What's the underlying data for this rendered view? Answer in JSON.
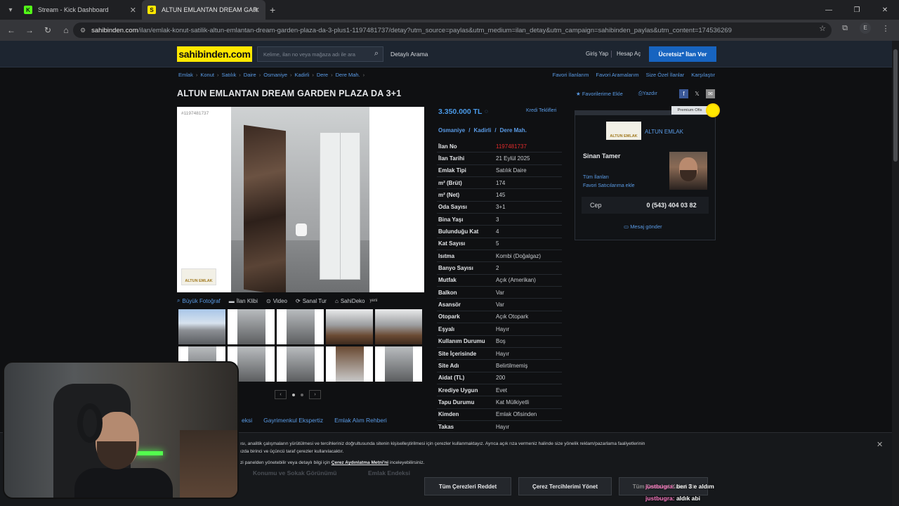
{
  "browser": {
    "tabs": [
      {
        "title": "Stream - Kick Dashboard",
        "favicon": "K"
      },
      {
        "title": "ALTUN EMLANTAN DREAM GAR",
        "favicon": "S"
      }
    ],
    "url_host": "sahibinden.com",
    "url_path": "/ilan/emlak-konut-satilik-altun-emlantan-dream-garden-plaza-da-3-plus1-1197481737/detay?utm_source=paylas&utm_medium=ilan_detay&utm_campaign=sahibinden_paylas&utm_content=174536269",
    "profile_initial": "E"
  },
  "header": {
    "logo": "sahibinden.com",
    "search_placeholder": "Kelime, ilan no veya mağaza adı ile ara",
    "detayli": "Detaylı Arama",
    "giris": "Giriş Yap",
    "hesap": "Hesap Aç",
    "cta": "Ücretsiz* İlan Ver"
  },
  "breadcrumbs": [
    "Emlak",
    "Konut",
    "Satılık",
    "Daire",
    "Osmaniye",
    "Kadirli",
    "Dere",
    "Dere Mah."
  ],
  "toplinks": [
    "Favori İlanlarım",
    "Favori Aramalarım",
    "Size Özel İlanlar",
    "Karşılaştır"
  ],
  "listing": {
    "title": "ALTUN EMLANTAN DREAM GARDEN PLAZA DA 3+1",
    "favorite": "Favorilerime Ekle",
    "print": "Yazdır",
    "photo_id": "#1197481737",
    "photo_tabs": [
      "Büyük Fotoğraf",
      "İlan Klibi",
      "Video",
      "Sanal Tur",
      "SahiDeko"
    ],
    "yeni": "yeni",
    "links": [
      "Gayrimenkul Ekspertiz",
      "Emlak Alım Rehberi"
    ],
    "links_partial": "eksi",
    "price": "3.350.000 TL",
    "kredi": "Kredi Teklifleri",
    "location": [
      "Osmaniye",
      "/",
      "Kadirli",
      "/",
      "Dere Mah."
    ],
    "details": [
      {
        "label": "İlan No",
        "value": "1197481737"
      },
      {
        "label": "İlan Tarihi",
        "value": "21 Eylül 2025"
      },
      {
        "label": "Emlak Tipi",
        "value": "Satılık Daire"
      },
      {
        "label": "m² (Brüt)",
        "value": "174"
      },
      {
        "label": "m² (Net)",
        "value": "145"
      },
      {
        "label": "Oda Sayısı",
        "value": "3+1"
      },
      {
        "label": "Bina Yaşı",
        "value": "3"
      },
      {
        "label": "Bulunduğu Kat",
        "value": "4"
      },
      {
        "label": "Kat Sayısı",
        "value": "5"
      },
      {
        "label": "Isıtma",
        "value": "Kombi (Doğalgaz)"
      },
      {
        "label": "Banyo Sayısı",
        "value": "2"
      },
      {
        "label": "Mutfak",
        "value": "Açık (Amerikan)"
      },
      {
        "label": "Balkon",
        "value": "Var"
      },
      {
        "label": "Asansör",
        "value": "Var"
      },
      {
        "label": "Otopark",
        "value": "Açık Otopark"
      },
      {
        "label": "Eşyalı",
        "value": "Hayır"
      },
      {
        "label": "Kullanım Durumu",
        "value": "Boş"
      },
      {
        "label": "Site İçerisinde",
        "value": "Hayır"
      },
      {
        "label": "Site Adı",
        "value": "Belirtilmemiş"
      },
      {
        "label": "Aidat (TL)",
        "value": "200"
      },
      {
        "label": "Krediye Uygun",
        "value": "Evet"
      },
      {
        "label": "Tapu Durumu",
        "value": "Kat Mülkiyetli"
      },
      {
        "label": "Kimden",
        "value": "Emlak Ofisinden"
      },
      {
        "label": "Takas",
        "value": "Hayır"
      }
    ]
  },
  "seller": {
    "premium": "Premium Ofis",
    "office": "ALTUN EMLAK",
    "logo_text": "ALTUN EMLAK",
    "agent": "Sinan Tamer",
    "all_listings": "Tüm İlanları",
    "fav_seller": "Favori Satıcılarıma ekle",
    "cep_label": "Cep",
    "cep_number": "0 (543) 404 03 82",
    "message": "Mesaj gönder"
  },
  "cookie": {
    "text1": "ısı, analitik çalışmaların yürütülmesi ve tercihleriniz doğrultusunda sitenin kişiselleştirilmesi için çerezler kullanmaktayız. Ayrıca açık rıza vermeniz halinde size yönelik reklam/pazarlama faaliyetlerinin",
    "text1b": "ızda birinci ve üçüncü taraf çerezler kullanılacaktır.",
    "text2_pre": "zi panelden yönetebilir veya detaylı bilgi için",
    "text2_link": "Çerez Aydınlatma Metni'ni",
    "text2_post": "inceleyebilirsiniz.",
    "btn_reject": "Tüm Çerezleri Reddet",
    "btn_manage": "Çerez Tercihlerimi Yönet",
    "btn_accept": "Tüm Çerezleri Kabul Et",
    "under_tabs": [
      "Konumu ve Sokak Görünümü",
      "Emlak Endeksi"
    ]
  },
  "chat": [
    {
      "user": "justbugra:",
      "msg": "ben 3 e aldım"
    },
    {
      "user": "justbugra:",
      "msg": "aldık abi"
    }
  ]
}
